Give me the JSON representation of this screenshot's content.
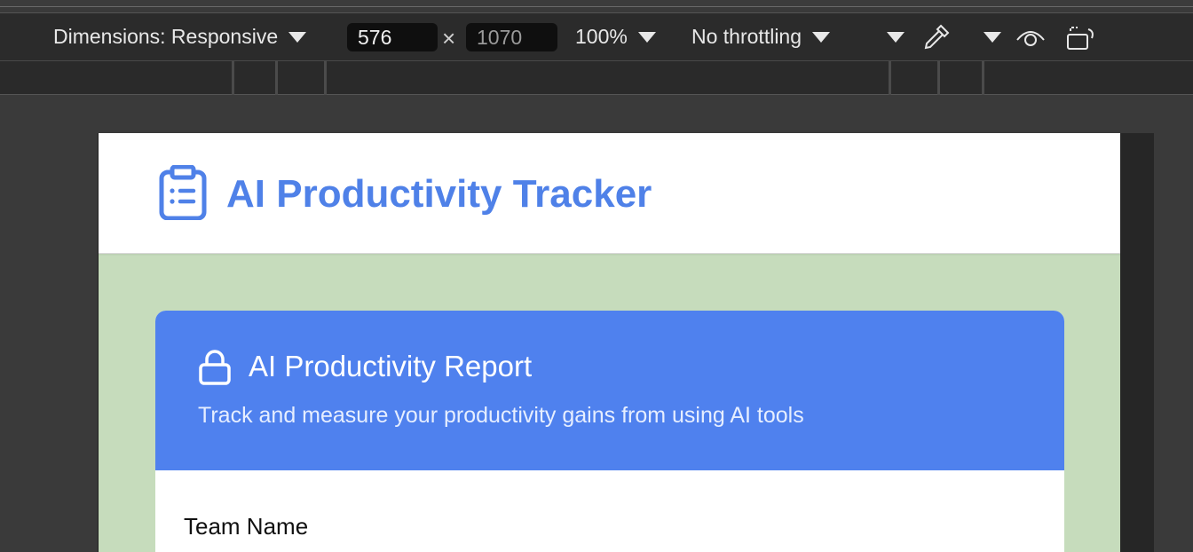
{
  "devtools": {
    "dimensions_label": "Dimensions: Responsive",
    "width_value": "576",
    "times_symbol": "×",
    "height_value": "1070",
    "zoom_label": "100%",
    "throttling_label": "No throttling"
  },
  "app": {
    "title": "AI Productivity Tracker",
    "accent_color": "#4f81e8",
    "background_color": "#c6dcbc"
  },
  "report_card": {
    "title": "AI Productivity Report",
    "subtitle": "Track and measure your productivity gains from using AI tools",
    "header_color": "#4f81ee"
  },
  "form": {
    "team_name_label": "Team Name"
  },
  "icons": [
    "chevron-down-icon",
    "eyedropper-icon",
    "eye-icon",
    "rotate-device-icon",
    "clipboard-list-icon",
    "lock-icon"
  ]
}
